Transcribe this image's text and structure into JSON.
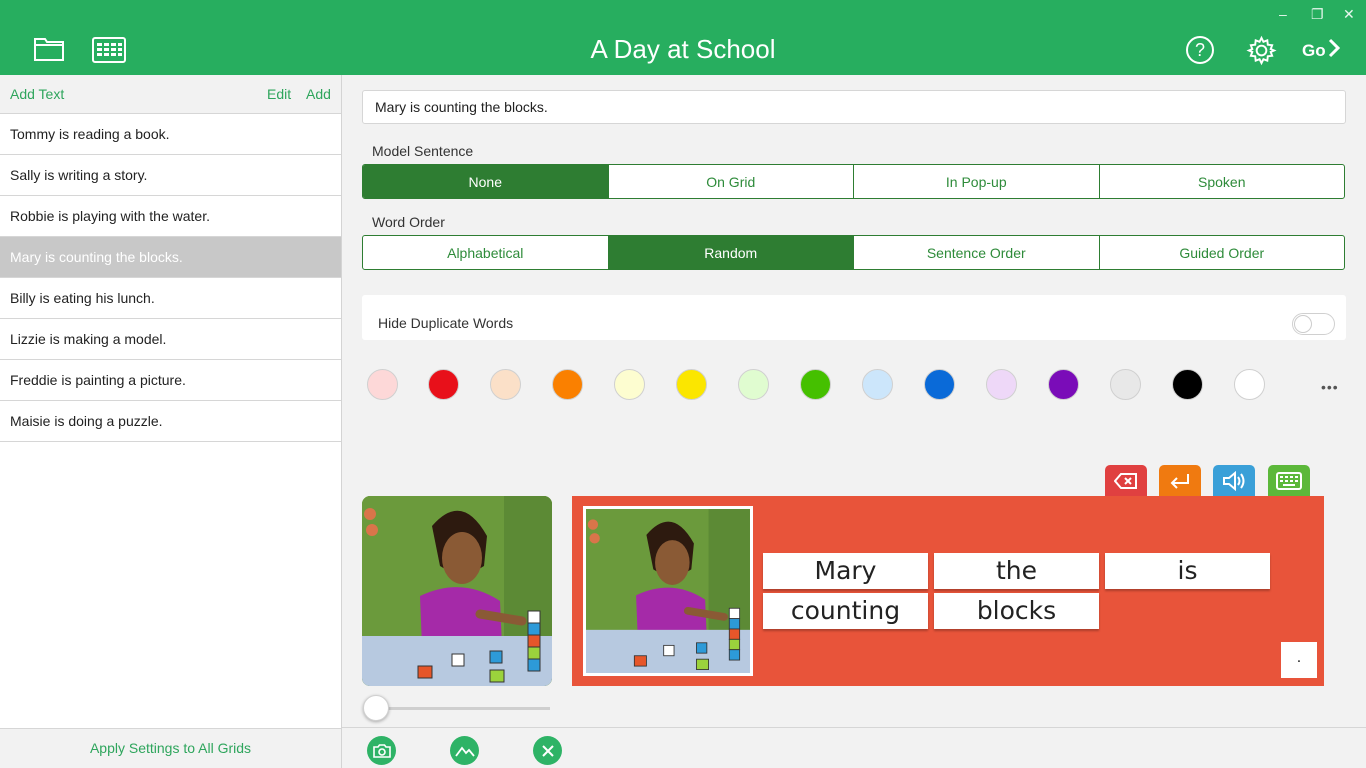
{
  "header": {
    "title": "A Day at School",
    "go_label": "Go",
    "left_icons": [
      "folder-icon",
      "grid-icon"
    ],
    "right_icons": [
      "help-icon",
      "gear-icon",
      "chevron-right-icon"
    ],
    "window_controls": {
      "minimize": "–",
      "restore": "❐",
      "close": "✕"
    }
  },
  "sidebar": {
    "add_text": "Add Text",
    "edit": "Edit",
    "add": "Add",
    "items": [
      "Tommy is reading a book.",
      "Sally is writing a story.",
      "Robbie is playing with the water.",
      "Mary is counting the blocks.",
      "Billy is eating his lunch.",
      "Lizzie is making a model.",
      "Freddie is painting a picture.",
      "Maisie is doing a puzzle."
    ],
    "selected_index": 3,
    "apply_all": "Apply Settings to All Grids"
  },
  "sentence": {
    "value": "Mary is counting the blocks."
  },
  "model_sentence": {
    "label": "Model Sentence",
    "options": [
      "None",
      "On Grid",
      "In Pop-up",
      "Spoken"
    ],
    "selected": "None"
  },
  "word_order": {
    "label": "Word Order",
    "options": [
      "Alphabetical",
      "Random",
      "Sentence Order",
      "Guided Order"
    ],
    "selected": "Random"
  },
  "hide_duplicates": {
    "label": "Hide Duplicate Words",
    "enabled": false
  },
  "colors": [
    "#fdd8d8",
    "#e8101a",
    "#fbe0c8",
    "#fa8000",
    "#fdfdd0",
    "#fbe600",
    "#e0fcd0",
    "#45c000",
    "#cce6fb",
    "#0a6ad8",
    "#eed8f8",
    "#7a0cb8",
    "#e8e8e8",
    "#000000",
    "#ffffff"
  ],
  "more_label": "•••",
  "keyboard_buttons": [
    {
      "name": "backspace",
      "color": "#e04040"
    },
    {
      "name": "enter",
      "color": "#f07a10"
    },
    {
      "name": "speak",
      "color": "#3aa0d8"
    },
    {
      "name": "keyboard",
      "color": "#5cb83a"
    }
  ],
  "words": [
    "Mary",
    "the",
    "is",
    "counting",
    "blocks"
  ],
  "punctuation": ".",
  "panel_color": "#e8543a",
  "picture_slider": 0,
  "bottom_buttons": [
    "camera-icon",
    "image-library-icon",
    "clear-icon"
  ],
  "accent_color": "#27ae5f"
}
